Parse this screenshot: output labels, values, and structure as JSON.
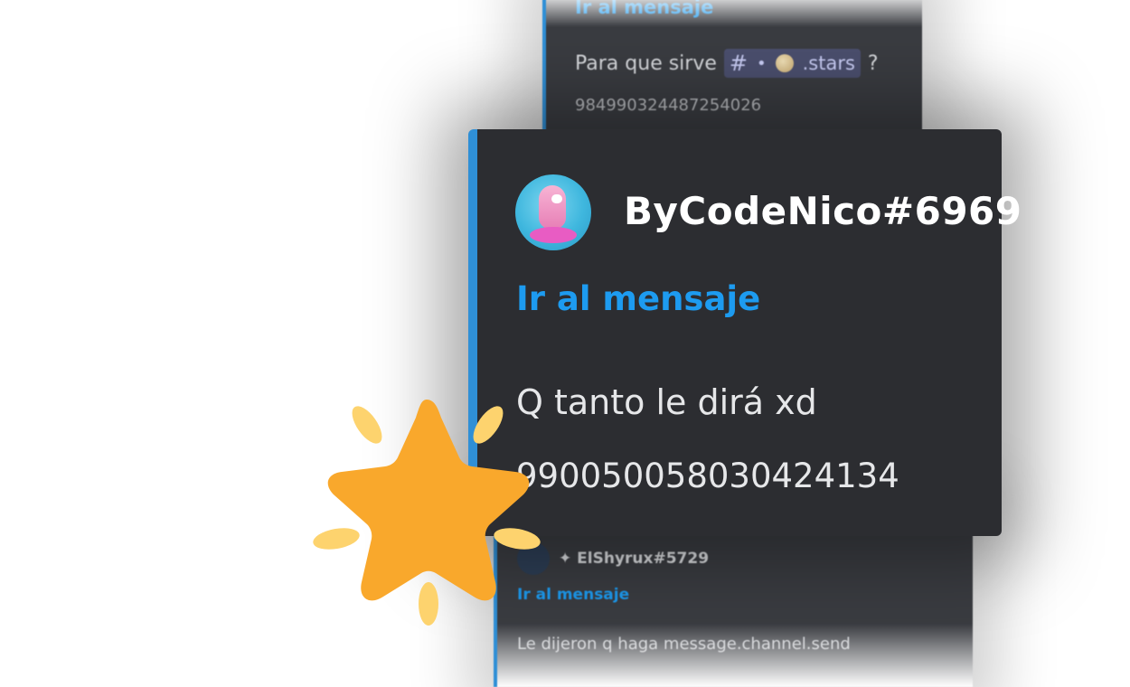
{
  "top_card": {
    "jump_link": "Ir al mensaje",
    "message_prefix": "Para que sirve",
    "channel_hash": "#",
    "channel_dot": "•",
    "channel_name": ".stars",
    "message_suffix": "?",
    "message_id": "984990324487254026"
  },
  "main_card": {
    "username": "ByCodeNico#6969",
    "jump_link": "Ir al mensaje",
    "message": "Q tanto le dirá xd",
    "message_id": "990050058030424134"
  },
  "bottom_card": {
    "username": "✦ ElShyrux#5729",
    "jump_link": "Ir al mensaje",
    "message": "Le dijeron q haga message.channel.send"
  },
  "colors": {
    "accent_blue": "#2f8fd6",
    "link_blue": "#1d9bf0",
    "card_bg": "#2c2d31",
    "star_orange": "#f9a82c",
    "star_sparkle": "#fdd36e"
  }
}
